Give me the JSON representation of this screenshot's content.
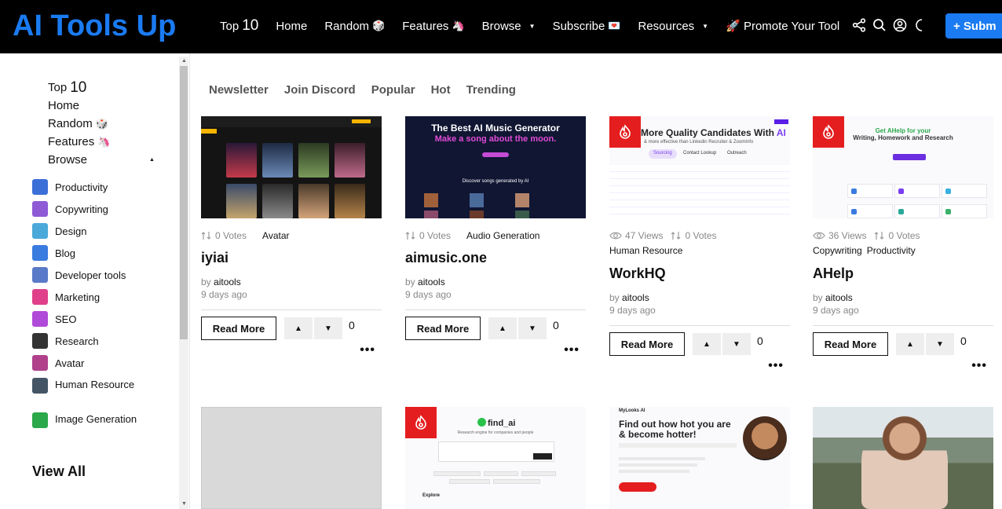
{
  "header": {
    "logo": "AI Tools Up",
    "nav": [
      {
        "label": "Top",
        "big": "10"
      },
      {
        "label": "Home"
      },
      {
        "label": "Random",
        "emoji": "🎲"
      },
      {
        "label": "Features",
        "emoji": "🦄"
      },
      {
        "label": "Browse",
        "caret": true
      },
      {
        "label": "Subscribe",
        "emoji": "💌"
      },
      {
        "label": "Resources",
        "caret": true
      },
      {
        "label": "🚀 Promote Your Tool"
      }
    ],
    "icons": [
      "share-icon",
      "search-icon",
      "user-icon",
      "moon-icon"
    ],
    "submit_label": "+ Subm"
  },
  "sidebar": {
    "nav": [
      {
        "label": "Top",
        "big": "10"
      },
      {
        "label": "Home"
      },
      {
        "label": "Random",
        "emoji": "🎲"
      },
      {
        "label": "Features",
        "emoji": "🦄"
      },
      {
        "label": "Browse"
      }
    ],
    "categories": [
      {
        "label": "Productivity",
        "color": "#3b6fd8"
      },
      {
        "label": "Copywriting",
        "color": "#8e5ad6"
      },
      {
        "label": "Design",
        "color": "#4aa9d8"
      },
      {
        "label": "Blog",
        "color": "#3a7be0"
      },
      {
        "label": "Developer tools",
        "color": "#5a79c8"
      },
      {
        "label": "Marketing",
        "color": "#e0408a"
      },
      {
        "label": "SEO",
        "color": "#b04ad8"
      },
      {
        "label": "Research",
        "color": "#333333"
      },
      {
        "label": "Avatar",
        "color": "#b0408a"
      },
      {
        "label": "Human Resource",
        "color": "#445566"
      },
      {
        "label": "Image Generation",
        "color": "#2aa84a"
      }
    ],
    "view_all": "View All"
  },
  "tabs": [
    "Newsletter",
    "Join Discord",
    "Popular",
    "Hot",
    "Trending"
  ],
  "cards": [
    {
      "title": "iyiai",
      "views": "",
      "votes": "0 Votes",
      "tags": [
        "Avatar"
      ],
      "author": "aitools",
      "ago": "9 days ago",
      "read_more": "Read More",
      "vote_count": "0"
    },
    {
      "title": "aimusic.one",
      "views": "",
      "votes": "0 Votes",
      "tags": [
        "Audio Generation"
      ],
      "author": "aitools",
      "ago": "9 days ago",
      "read_more": "Read More",
      "vote_count": "0"
    },
    {
      "title": "WorkHQ",
      "views": "47 Views",
      "votes": "0 Votes",
      "tags": [
        "Human Resource"
      ],
      "author": "aitools",
      "ago": "9 days ago",
      "read_more": "Read More",
      "vote_count": "0"
    },
    {
      "title": "AHelp",
      "views": "36 Views",
      "votes": "0 Votes",
      "tags": [
        "Copywriting",
        "Productivity"
      ],
      "author": "aitools",
      "ago": "9 days ago",
      "read_more": "Read More",
      "vote_count": "0"
    }
  ],
  "thumbs": {
    "music_h1": "The Best AI Music Generator",
    "music_h2": "Make a song about the moon.",
    "music_sec": "Discover songs generated by AI",
    "work_hl_a": "More Quality Candidates With ",
    "work_hl_b": "AI",
    "work_sub": "& more effective than Linkedin Recruiter & ZoomInfo",
    "work_pills": [
      "Sourcing",
      "Contact Lookup",
      "Outreach"
    ],
    "ahelp_hl_a": "Get AHelp for your",
    "ahelp_hl_b": "Writing, Homework and Research",
    "find_logo": "find_ai",
    "find_sub": "Research engine for companies and people",
    "find_explore": "Explore",
    "looks_brand": "MyLooks AI",
    "looks_hl": "Find out how hot you are & become hotter!"
  },
  "by_label": "by"
}
